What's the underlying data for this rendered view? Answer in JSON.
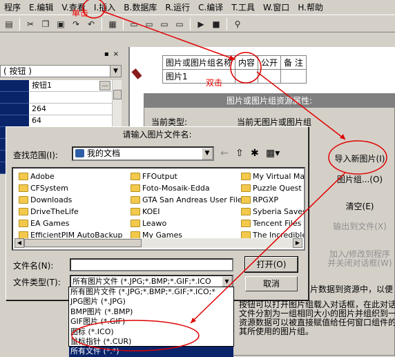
{
  "menubar": {
    "items": [
      "程序",
      "E.编辑",
      "V.查看",
      "I.插入",
      "B.数据库",
      "R.运行",
      "C.编译",
      "T.工具",
      "W.窗口",
      "H.帮助"
    ]
  },
  "toolbar": {
    "icons": [
      "save-icon",
      "cut-icon",
      "copy-icon",
      "paste-icon",
      "redo-icon",
      "undo-icon",
      "find-icon",
      "window-layout-icon",
      "run-icon",
      "stop-icon",
      "binoculars-icon"
    ]
  },
  "left_panel": {
    "combo_value": "( 按钮 )",
    "properties": [
      "按钮1",
      "",
      "264",
      "64",
      "",
      "",
      "",
      ""
    ]
  },
  "resource_grid": {
    "headers": [
      "图片或图片组名称",
      "内容",
      "公开",
      "备 注"
    ],
    "row": [
      "图片1",
      "",
      "",
      ""
    ]
  },
  "property_dialog": {
    "title": "图片或图片组资源属性:",
    "current_type_label": "当前类型:",
    "current_type_value": "当前无图片或图片组",
    "buttons": {
      "import_image": "导入新图片(I)",
      "image_group": "图片组...(O)",
      "clear": "清空(E)",
      "export": "输出到文件(X)",
      "add_modify": "加入/修改到程序并关闭对话框(W)"
    },
    "desc_right": "片数据到资源中，以便",
    "desc_lines": [
      "按钮可以打开图片组载入对话框，在此对话",
      "文件分割为一组相同大小的图片并组织到一起",
      "资源数据可以被直接赋值给任何窗口组件的\"",
      "其所使用的图片组。"
    ]
  },
  "file_dialog": {
    "title": "请输入图片文件名:",
    "look_in_label": "查找范围(I):",
    "look_in_value": "我的文档",
    "folders_col1": [
      "Adobe",
      "CFSystem",
      "Downloads",
      "DriveTheLife",
      "EA Games",
      "EfficientPIM AutoBackup"
    ],
    "folders_col2": [
      "FFOutput",
      "Foto-Mosaik-Edda",
      "GTA San Andreas User Files",
      "KOEI",
      "Leawo",
      "My Games"
    ],
    "folders_col3": [
      "My Virtual Mach",
      "Puzzle Quest",
      "RPGXP",
      "Syberia Saves",
      "Tencent Files",
      "The Incredible I"
    ],
    "filename_label": "文件名(N):",
    "filename_value": "",
    "filetype_label": "文件类型(T):",
    "filetype_value": "所有图片文件 (*.JPG;*.BMP;*.GIF;*.ICO",
    "open_button": "打开(O)",
    "cancel_button": "取消"
  },
  "filetype_dropdown": {
    "options": [
      "所有图片文件 (*.JPG;*.BMP;*.GIF;*.ICO;*",
      "JPG图片 (*.JPG)",
      "BMP图片 (*.BMP)",
      "GIF图片 (*.GIF)",
      "图标 (*.ICO)",
      "鼠标指针 (*.CUR)",
      "所有文件 (*.*)"
    ],
    "selected_index": 6
  },
  "annotations": {
    "click_label": "单击",
    "dblclick_label": "双击"
  },
  "colors": {
    "annotation_red": "#e00000",
    "selection_blue": "#0a246a",
    "dialog_gray": "#d4d0c8"
  }
}
